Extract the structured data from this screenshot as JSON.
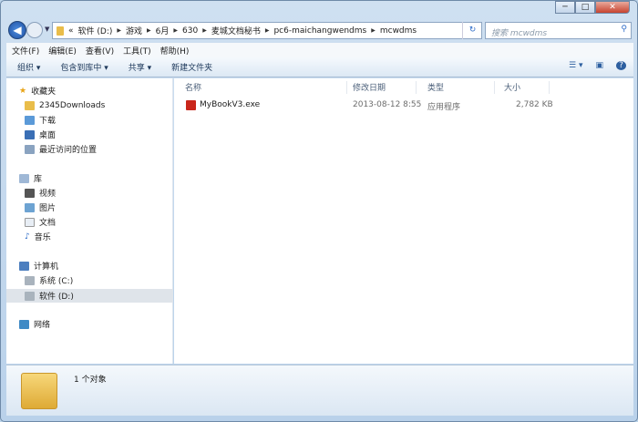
{
  "window": {
    "minimize": "─",
    "maximize": "□",
    "close": "✕"
  },
  "nav": {
    "back": "◀",
    "breadcrumb": [
      "«",
      "软件 (D:)",
      "游戏",
      "6月",
      "630",
      "麦城文档秘书",
      "pc6-maichangwendms",
      "mcwdms"
    ],
    "search_placeholder": "搜索 mcwdms"
  },
  "menu": [
    "文件(F)",
    "编辑(E)",
    "查看(V)",
    "工具(T)",
    "帮助(H)"
  ],
  "toolbar": {
    "organize": "组织 ▾",
    "include": "包含到库中 ▾",
    "share": "共享 ▾",
    "new_folder": "新建文件夹"
  },
  "sidebar": {
    "favorites": "收藏夹",
    "fav_items": [
      "2345Downloads",
      "下载",
      "桌面",
      "最近访问的位置"
    ],
    "libraries": "库",
    "lib_items": [
      "视频",
      "图片",
      "文档",
      "音乐"
    ],
    "computer": "计算机",
    "comp_items": [
      "系统 (C:)",
      "软件 (D:)"
    ],
    "network": "网络"
  },
  "columns": [
    "名称",
    "修改日期",
    "类型",
    "大小"
  ],
  "files": [
    {
      "name": "MyBookV3.exe",
      "date": "2013-08-12 8:55",
      "type": "应用程序",
      "size": "2,782 KB"
    }
  ],
  "status": {
    "count": "1 个对象"
  }
}
